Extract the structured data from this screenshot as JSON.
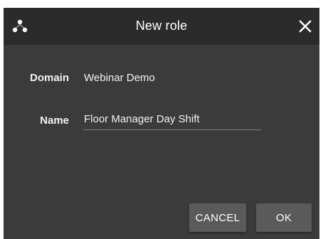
{
  "dialog": {
    "title": "New role",
    "app_icon": "three-node-logo-icon",
    "close_icon": "close-icon"
  },
  "form": {
    "domain_label": "Domain",
    "domain_value": "Webinar Demo",
    "name_label": "Name",
    "name_value": "Floor Manager Day Shift"
  },
  "buttons": {
    "cancel_label": "CANCEL",
    "ok_label": "OK"
  },
  "colors": {
    "titlebar": "#2b2b2b",
    "body": "#3b3b3b",
    "button": "#5a5a5a"
  }
}
